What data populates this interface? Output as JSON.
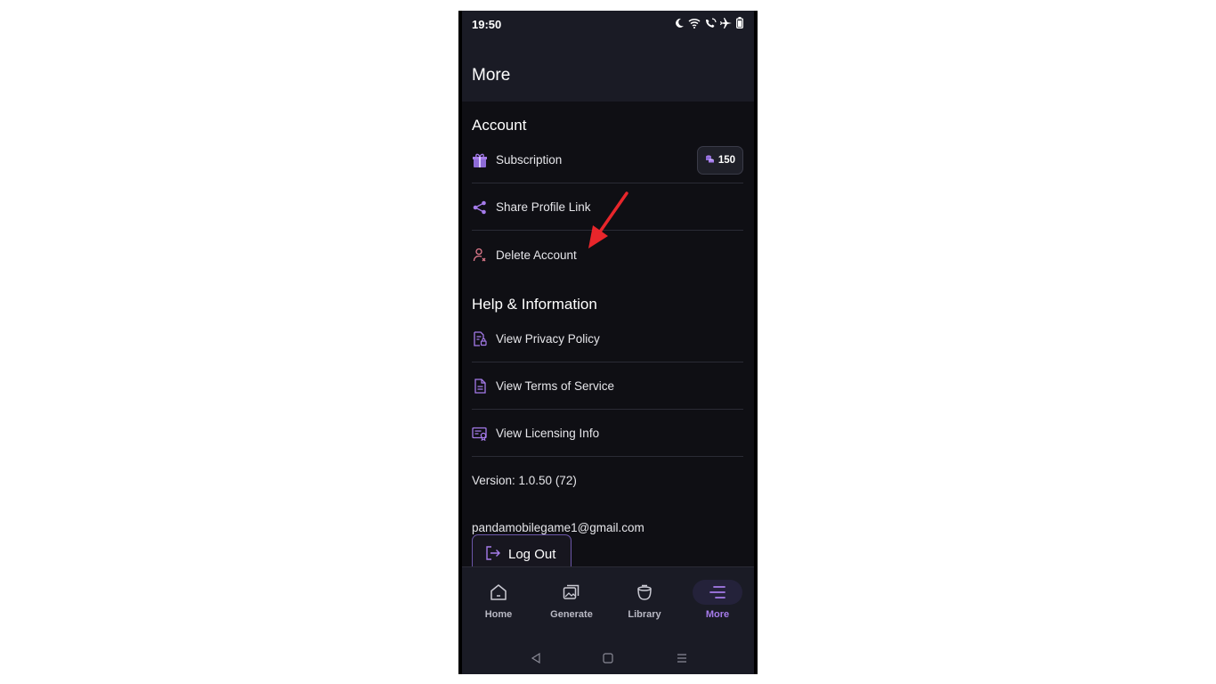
{
  "status_bar": {
    "time": "19:50",
    "icons": [
      "moon-icon",
      "wifi-icon",
      "wifi-call-icon",
      "airplane-icon",
      "battery-icon"
    ]
  },
  "header": {
    "title": "More"
  },
  "account": {
    "title": "Account",
    "items": [
      {
        "label": "Subscription",
        "icon": "subscription-gift-icon"
      },
      {
        "label": "Share Profile Link",
        "icon": "share-icon"
      },
      {
        "label": "Delete Account",
        "icon": "delete-user-icon"
      }
    ],
    "credits_badge": {
      "value": "150",
      "icon": "coins-icon"
    }
  },
  "help": {
    "title": "Help & Information",
    "items": [
      {
        "label": "View Privacy Policy",
        "icon": "privacy-document-icon"
      },
      {
        "label": "View Terms of Service",
        "icon": "document-icon"
      },
      {
        "label": "View Licensing Info",
        "icon": "license-certificate-icon"
      }
    ]
  },
  "version": "Version: 1.0.50 (72)",
  "email": "pandamobilegame1@gmail.com",
  "logout_label": "Log Out",
  "bottom_nav": [
    {
      "label": "Home",
      "icon": "home-icon"
    },
    {
      "label": "Generate",
      "icon": "images-icon"
    },
    {
      "label": "Library",
      "icon": "library-pot-icon"
    },
    {
      "label": "More",
      "icon": "menu-lines-icon",
      "active": true
    }
  ],
  "colors": {
    "accent": "#a57bea",
    "background": "#0f0f14",
    "header_bg": "#1a1b25",
    "annotation_arrow": "#e8262b",
    "delete_icon": "#e07a8c"
  }
}
